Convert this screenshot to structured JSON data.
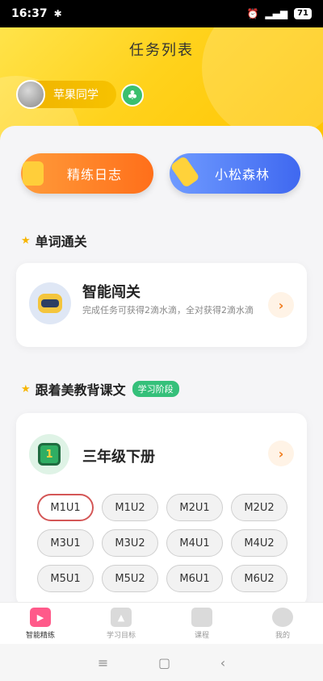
{
  "statusbar": {
    "time": "16:37",
    "battery": "71"
  },
  "header": {
    "title": "任务列表",
    "user_name": "苹果同学"
  },
  "actions": {
    "log_label": "精练日志",
    "forest_label": "小松森林"
  },
  "section_words": {
    "title": "单词通关"
  },
  "card_challenge": {
    "title": "智能闯关",
    "desc": "完成任务可获得2滴水滴，全对获得2滴水滴"
  },
  "section_texts": {
    "title": "跟着美教背课文",
    "badge": "学习阶段"
  },
  "card_book": {
    "title": "三年级下册",
    "units": [
      "M1U1",
      "M1U2",
      "M2U1",
      "M2U2",
      "M3U1",
      "M3U2",
      "M4U1",
      "M4U2",
      "M5U1",
      "M5U2",
      "M6U1",
      "M6U2"
    ],
    "selected": "M1U1"
  },
  "tabs": [
    {
      "label": "智能精练",
      "active": true
    },
    {
      "label": "学习目标",
      "active": false
    },
    {
      "label": "课程",
      "active": false
    },
    {
      "label": "我的",
      "active": false
    }
  ],
  "colors": {
    "accent_yellow": "#ffd21c",
    "log_orange": "#ff6f1a",
    "forest_blue": "#3f68f0",
    "stage_green": "#35c07a",
    "active_tab": "#ff5a8a"
  }
}
